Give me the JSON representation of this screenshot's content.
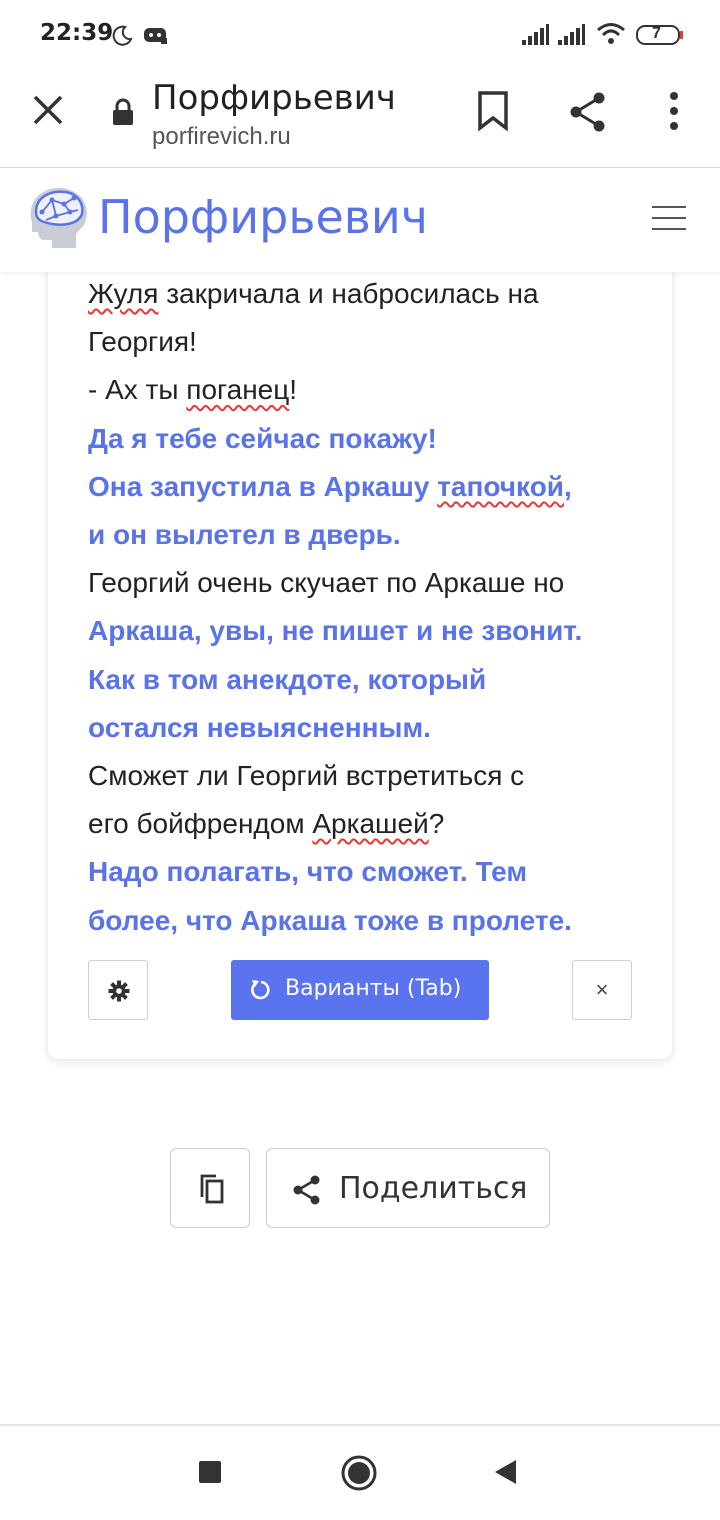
{
  "status_bar": {
    "time": "22:39",
    "battery": "7",
    "icons": [
      "moon-icon",
      "discord-icon",
      "signal-icon",
      "signal-icon",
      "wifi-icon",
      "battery-icon"
    ]
  },
  "browser": {
    "page_title": "Порфирьевич",
    "url": "porfirevich.ru",
    "icons": [
      "close-icon",
      "lock-icon",
      "bookmark-icon",
      "share-icon",
      "more-vert-icon"
    ]
  },
  "site": {
    "name": "Порфирьевич",
    "icons": [
      "brain-logo-icon",
      "menu-icon"
    ]
  },
  "story": {
    "lines": [
      {
        "parts": [
          {
            "t": "Жуля",
            "sq": true
          },
          {
            "t": " закричала и набросилась на"
          }
        ],
        "gen": false
      },
      {
        "parts": [
          {
            "t": "Георгия!"
          }
        ],
        "gen": false
      },
      {
        "parts": [
          {
            "t": "- Ах ты "
          },
          {
            "t": "поганец",
            "sq": true
          },
          {
            "t": "!"
          }
        ],
        "gen": false
      },
      {
        "parts": [
          {
            "t": "Да я тебе сейчас покажу!"
          }
        ],
        "gen": true
      },
      {
        "parts": [
          {
            "t": "Она запустила в Аркашу "
          },
          {
            "t": "тапочкой",
            "sq": true
          },
          {
            "t": ","
          }
        ],
        "gen": true
      },
      {
        "parts": [
          {
            "t": "и он вылетел в дверь."
          }
        ],
        "gen": true
      },
      {
        "parts": [
          {
            "t": "Георгий очень скучает по Аркаше но"
          }
        ],
        "gen": false
      },
      {
        "parts": [
          {
            "t": "Аркаша, увы, не пишет и не звонит."
          }
        ],
        "gen": true
      },
      {
        "parts": [
          {
            "t": "Как в том анекдоте, который"
          }
        ],
        "gen": true
      },
      {
        "parts": [
          {
            "t": "остался невыясненным."
          }
        ],
        "gen": true
      },
      {
        "parts": [
          {
            "t": "Сможет ли Георгий встретиться с"
          }
        ],
        "gen": false
      },
      {
        "parts": [
          {
            "t": "его бойфрендом "
          },
          {
            "t": "Аркашей",
            "sq": true
          },
          {
            "t": "?"
          }
        ],
        "gen": false
      },
      {
        "parts": [
          {
            "t": "Надо полагать, что сможет. Тем"
          }
        ],
        "gen": true
      },
      {
        "parts": [
          {
            "t": "более, что Аркаша тоже в пролете."
          }
        ],
        "gen": true
      }
    ]
  },
  "controls": {
    "variants_label": "Варианты (Tab)",
    "close_symbol": "×",
    "icons": [
      "gear-icon",
      "refresh-icon",
      "close-icon"
    ]
  },
  "actions": {
    "share_label": "Поделиться",
    "icons": [
      "copy-icon",
      "share-icon"
    ]
  },
  "nav": {
    "icons": [
      "recents-square-icon",
      "home-circle-icon",
      "back-triangle-icon"
    ]
  },
  "colors": {
    "accent": "#5a73e8",
    "button": "#5a73ef",
    "spell_error": "#e53935"
  }
}
